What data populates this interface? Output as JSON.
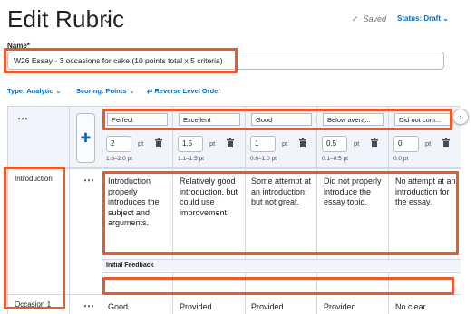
{
  "page": {
    "title": "Edit Rubric",
    "saved_label": "Saved",
    "status_label": "Status: Draft"
  },
  "name_field": {
    "label": "Name*",
    "value": "W26 Essay - 3 occasions for cake (10 points total x 5 criteria)"
  },
  "options": {
    "type_label": "Type: Analytic",
    "scoring_label": "Scoring: Points",
    "reverse_label": "Reverse Level Order"
  },
  "levels": [
    {
      "name": "Perfect",
      "points": "2",
      "unit": "pt",
      "range": "1.6–2.0 pt"
    },
    {
      "name": "Excellent",
      "points": "1.5",
      "unit": "pt",
      "range": "1.1–1.5 pt"
    },
    {
      "name": "Good",
      "points": "1",
      "unit": "pt",
      "range": "0.6–1.0 pt"
    },
    {
      "name": "Below avera...",
      "points": "0.5",
      "unit": "pt",
      "range": "0.1–0.5 pt"
    },
    {
      "name": "Did not com...",
      "points": "0",
      "unit": "pt",
      "range": "0.0 pt"
    }
  ],
  "criteria": [
    {
      "name": "Introduction",
      "descriptions": [
        "Introduction properly introduces the subject and arguments.",
        "Relatively good introduction, but could use improvement.",
        "Some attempt at an introduction, but not great.",
        "Did not properly introduce the essay topic.",
        "No attempt at an introduction for the essay."
      ],
      "feedback_label": "Initial Feedback"
    },
    {
      "name": "Occasion 1",
      "descriptions": [
        "Good",
        "Provided",
        "Provided",
        "Provided",
        "No clear"
      ]
    }
  ],
  "icons": {
    "title_chevron": "chevron-down-icon",
    "saved_check": "checkmark-icon",
    "add_level": "plus-icon",
    "delete_level": "trash-icon",
    "scroll_right": "chevron-right-icon",
    "more": "more-horizontal-icon",
    "reverse": "swap-icon"
  },
  "colors": {
    "accent": "#006fbf",
    "highlight": "#e85a2c",
    "header_bg": "#f1f5fb"
  }
}
